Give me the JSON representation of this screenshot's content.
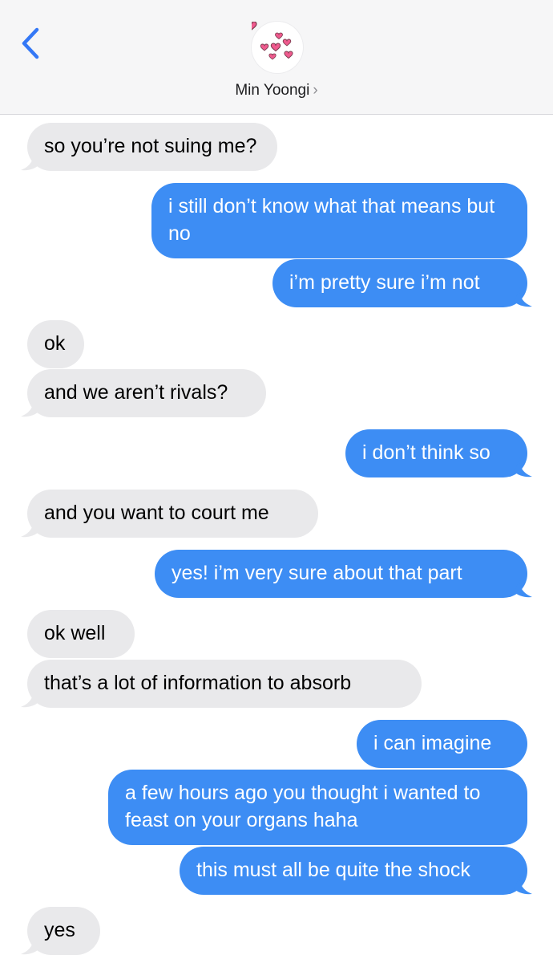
{
  "header": {
    "back_icon": "chevron-left-icon",
    "avatar_icon": "hearts-icon",
    "contact_name": "Min Yoongi",
    "contact_chevron": "›"
  },
  "colors": {
    "incoming_bubble": "#e9e9eb",
    "outgoing_bubble": "#3d8df4",
    "accent": "#3478f6",
    "heart": "#ef5a8e"
  },
  "messages": [
    {
      "from": "them",
      "text": "so you’re not suing me?"
    },
    {
      "from": "me",
      "text": "i still don’t know what that means but no"
    },
    {
      "from": "me",
      "text": "i’m pretty sure i’m not"
    },
    {
      "from": "them",
      "text": "ok"
    },
    {
      "from": "them",
      "text": "and we aren’t rivals?"
    },
    {
      "from": "me",
      "text": "i don’t think so"
    },
    {
      "from": "them",
      "text": "and you want to court me"
    },
    {
      "from": "me",
      "text": "yes! i’m very sure about that part"
    },
    {
      "from": "them",
      "text": "ok well"
    },
    {
      "from": "them",
      "text": "that’s a lot of information to absorb"
    },
    {
      "from": "me",
      "text": "i can imagine"
    },
    {
      "from": "me",
      "text": "a few hours ago you thought i wanted to feast on your organs haha"
    },
    {
      "from": "me",
      "text": "this must all be quite the shock"
    },
    {
      "from": "them",
      "text": "yes"
    }
  ]
}
